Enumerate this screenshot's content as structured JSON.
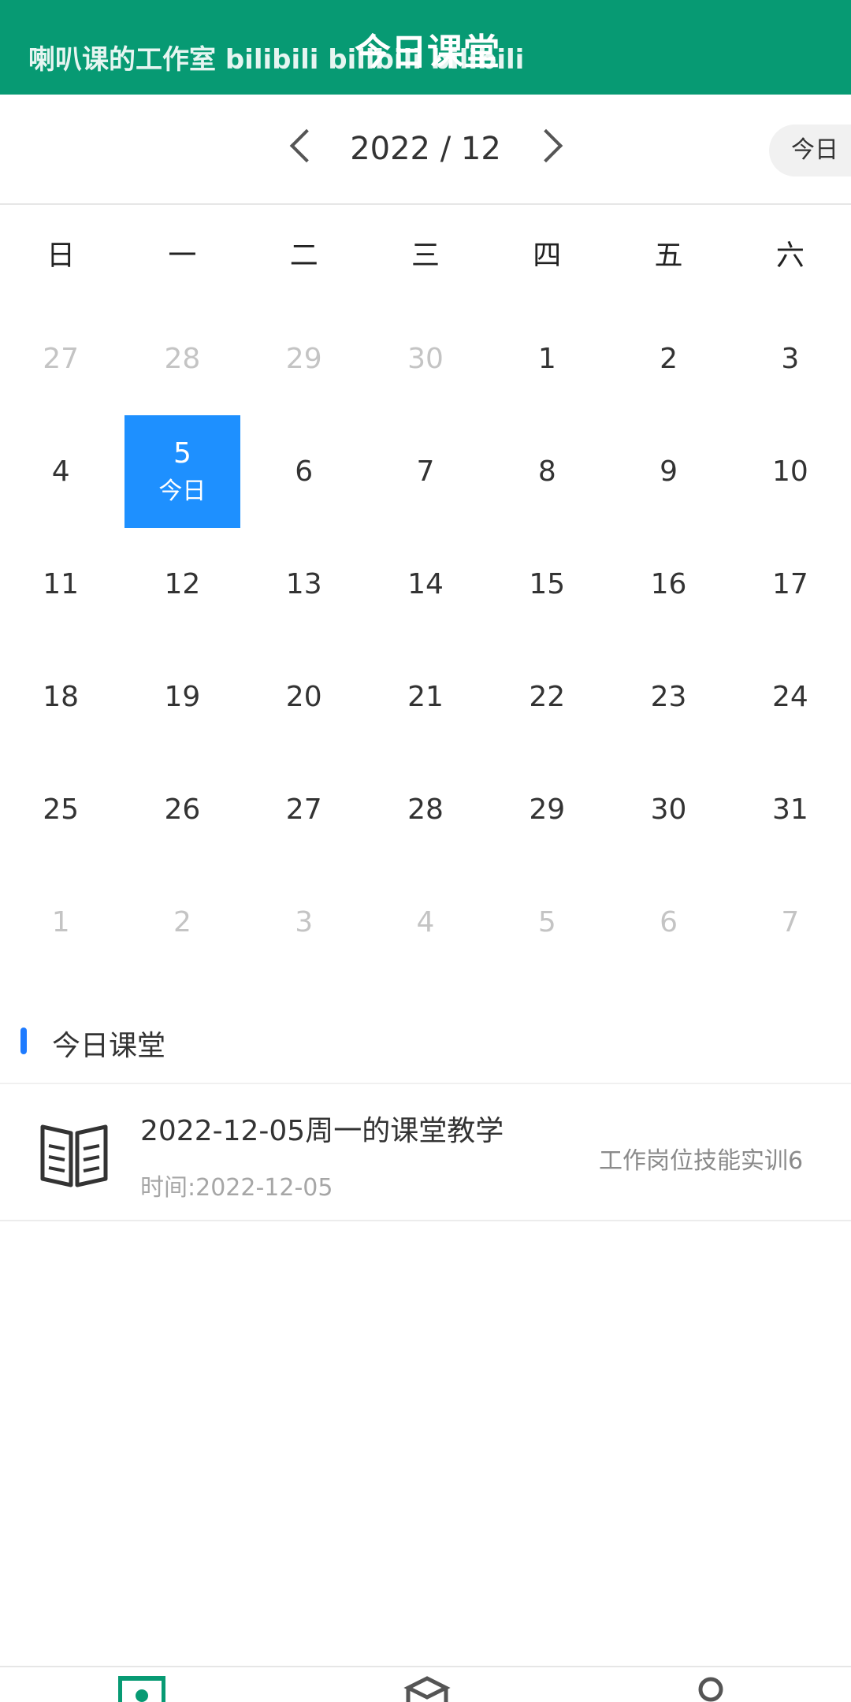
{
  "header": {
    "overlay_text": "喇叭课的工作室 bilibili bilibili bilibili",
    "title": "今日课堂",
    "color": "#079a73"
  },
  "nav": {
    "month_label": "2022 / 12",
    "today_button": "今日"
  },
  "weekdays": [
    "日",
    "一",
    "二",
    "三",
    "四",
    "五",
    "六"
  ],
  "calendar": {
    "days": [
      {
        "d": "27",
        "muted": true
      },
      {
        "d": "28",
        "muted": true
      },
      {
        "d": "29",
        "muted": true
      },
      {
        "d": "30",
        "muted": true
      },
      {
        "d": "1"
      },
      {
        "d": "2"
      },
      {
        "d": "3"
      },
      {
        "d": "4"
      },
      {
        "d": "5",
        "selected": true,
        "sub": "今日"
      },
      {
        "d": "6"
      },
      {
        "d": "7"
      },
      {
        "d": "8"
      },
      {
        "d": "9"
      },
      {
        "d": "10"
      },
      {
        "d": "11"
      },
      {
        "d": "12"
      },
      {
        "d": "13"
      },
      {
        "d": "14"
      },
      {
        "d": "15"
      },
      {
        "d": "16"
      },
      {
        "d": "17"
      },
      {
        "d": "18"
      },
      {
        "d": "19"
      },
      {
        "d": "20"
      },
      {
        "d": "21"
      },
      {
        "d": "22"
      },
      {
        "d": "23"
      },
      {
        "d": "24"
      },
      {
        "d": "25"
      },
      {
        "d": "26"
      },
      {
        "d": "27"
      },
      {
        "d": "28"
      },
      {
        "d": "29"
      },
      {
        "d": "30"
      },
      {
        "d": "31"
      },
      {
        "d": "1",
        "muted": true
      },
      {
        "d": "2",
        "muted": true
      },
      {
        "d": "3",
        "muted": true
      },
      {
        "d": "4",
        "muted": true
      },
      {
        "d": "5",
        "muted": true
      },
      {
        "d": "6",
        "muted": true
      },
      {
        "d": "7",
        "muted": true
      }
    ],
    "selected_color": "#1e90ff"
  },
  "section": {
    "title": "今日课堂",
    "accent": "#1e7bff"
  },
  "class_card": {
    "title": "2022-12-05周一的课堂教学",
    "time": "时间:2022-12-05",
    "course": "工作岗位技能实训6",
    "icon": "book-icon"
  },
  "tabbar": {
    "icons": [
      "home-icon",
      "box-icon",
      "user-icon"
    ],
    "active_color": "#079a73"
  }
}
